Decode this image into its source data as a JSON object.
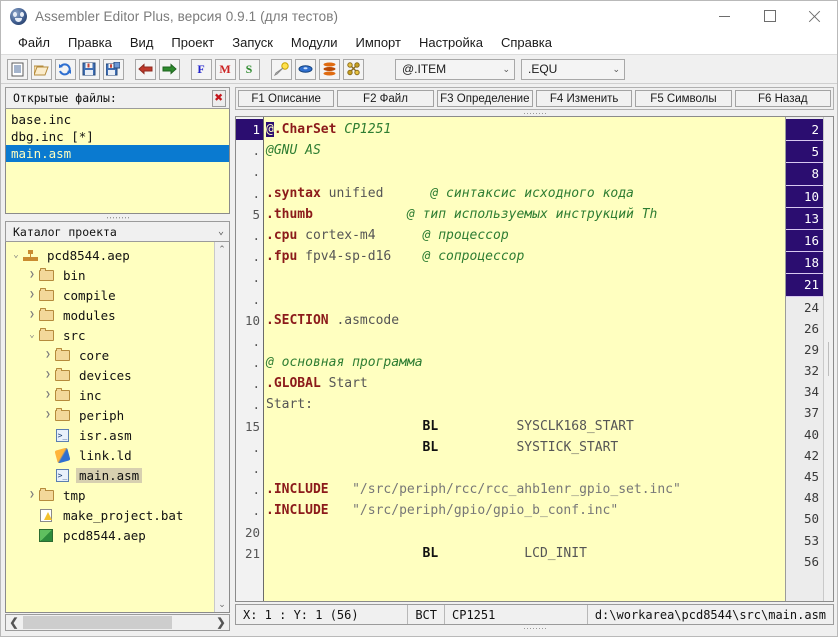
{
  "window": {
    "title": "Assembler Editor Plus, версия 0.9.1 (для тестов)",
    "app_icon": "paw-icon",
    "minimize": "minimize-icon",
    "maximize": "maximize-icon",
    "close": "close-icon"
  },
  "menu": [
    {
      "label": "Файл"
    },
    {
      "label": "Правка"
    },
    {
      "label": "Вид"
    },
    {
      "label": "Проект"
    },
    {
      "label": "Запуск"
    },
    {
      "label": "Модули"
    },
    {
      "label": "Импорт"
    },
    {
      "label": "Настройка"
    },
    {
      "label": "Справка"
    }
  ],
  "toolbar": {
    "buttons": [
      {
        "name": "new-file-icon",
        "glyph": "▤",
        "color": "#3b5a8c"
      },
      {
        "name": "open-folder-icon",
        "glyph": "▭",
        "color": "#c8963e"
      },
      {
        "name": "refresh-icon",
        "glyph": "⟳",
        "color": "#2f6fd0"
      },
      {
        "name": "save-icon",
        "glyph": "▣",
        "color": "#2f6fd0"
      },
      {
        "name": "save-all-icon",
        "glyph": "▣",
        "color": "#2f6fd0"
      },
      {
        "name": "back-arrow-icon",
        "glyph": "←",
        "color": "#c0392b"
      },
      {
        "name": "forward-arrow-icon",
        "glyph": "→",
        "color": "#2e8b2e"
      },
      {
        "name": "find-icon",
        "glyph": "F",
        "color": "#2222cc"
      },
      {
        "name": "macro-icon",
        "glyph": "M",
        "color": "#cc2222"
      },
      {
        "name": "symbols-icon",
        "glyph": "S",
        "color": "#2e8b2e"
      },
      {
        "name": "highlight-pen-icon",
        "glyph": "✐",
        "color": "#d8a400"
      },
      {
        "name": "disk-icon",
        "glyph": "⬬",
        "color": "#2f6fd0"
      },
      {
        "name": "stack-layers-icon",
        "glyph": "≡",
        "color": "#d04a00"
      },
      {
        "name": "link-nodes-icon",
        "glyph": "⁂",
        "color": "#b8860b"
      }
    ],
    "combo_item": {
      "value": "@.ITEM",
      "chevron": "chevron-down-icon"
    },
    "combo_equ": {
      "value": ".EQU",
      "chevron": "chevron-down-icon"
    }
  },
  "sidebar": {
    "files_panel": {
      "title": "Открытые файлы:",
      "close_icon": "✖",
      "items": [
        {
          "label": "base.inc",
          "selected": false
        },
        {
          "label": "dbg.inc [*]",
          "selected": false
        },
        {
          "label": "main.asm",
          "selected": true
        }
      ]
    },
    "tree_panel": {
      "title": "Каталог проекта",
      "chevron": "chevron-down-icon",
      "nodes": [
        {
          "label": "pcd8544.aep",
          "indent": 0,
          "arrow": "v",
          "icon": "project-icon",
          "selected": false
        },
        {
          "label": "bin",
          "indent": 1,
          "arrow": ">",
          "icon": "folder-icon",
          "selected": false
        },
        {
          "label": "compile",
          "indent": 1,
          "arrow": ">",
          "icon": "folder-icon",
          "selected": false
        },
        {
          "label": "modules",
          "indent": 1,
          "arrow": ">",
          "icon": "folder-icon",
          "selected": false
        },
        {
          "label": "src",
          "indent": 1,
          "arrow": "v",
          "icon": "folder-icon",
          "selected": false
        },
        {
          "label": "core",
          "indent": 2,
          "arrow": ">",
          "icon": "folder-icon",
          "selected": false
        },
        {
          "label": "devices",
          "indent": 2,
          "arrow": ">",
          "icon": "folder-icon",
          "selected": false
        },
        {
          "label": "inc",
          "indent": 2,
          "arrow": ">",
          "icon": "folder-icon",
          "selected": false
        },
        {
          "label": "periph",
          "indent": 2,
          "arrow": ">",
          "icon": "folder-icon",
          "selected": false
        },
        {
          "label": "isr.asm",
          "indent": 2,
          "arrow": "",
          "icon": "asm-file-icon",
          "selected": false
        },
        {
          "label": "link.ld",
          "indent": 2,
          "arrow": "",
          "icon": "linker-file-icon",
          "selected": false
        },
        {
          "label": "main.asm",
          "indent": 2,
          "arrow": "",
          "icon": "asm-file-icon",
          "selected": true
        },
        {
          "label": "tmp",
          "indent": 1,
          "arrow": ">",
          "icon": "folder-icon",
          "selected": false
        },
        {
          "label": "make_project.bat",
          "indent": 1,
          "arrow": "",
          "icon": "bat-file-icon",
          "selected": false
        },
        {
          "label": "pcd8544.aep",
          "indent": 1,
          "arrow": "",
          "icon": "aep-file-icon",
          "selected": false
        }
      ],
      "scroll_up": "scroll-up-icon",
      "scroll_down": "scroll-down-icon",
      "hscroll_left": "❮",
      "hscroll_right": "❯"
    }
  },
  "fkeys": [
    {
      "label": "F1 Описание"
    },
    {
      "label": "F2 Файл"
    },
    {
      "label": "F3 Определение"
    },
    {
      "label": "F4 Изменить"
    },
    {
      "label": "F5 Символы"
    },
    {
      "label": "F6 Назад"
    }
  ],
  "editor": {
    "gutter": [
      "1",
      ".",
      ".",
      ".",
      "5",
      ".",
      ".",
      ".",
      ".",
      "10",
      ".",
      ".",
      ".",
      ".",
      "15",
      ".",
      ".",
      ".",
      ".",
      "20",
      "21"
    ],
    "current_line": 1,
    "lines": [
      {
        "n": 1,
        "segs": [
          {
            "t": "@",
            "c": "cursorchar"
          },
          {
            "t": ".CharSet ",
            "c": "k"
          },
          {
            "t": "CP1251",
            "c": "cm"
          }
        ]
      },
      {
        "n": 2,
        "segs": [
          {
            "t": "@GNU AS",
            "c": "cm"
          }
        ]
      },
      {
        "n": 3,
        "segs": []
      },
      {
        "n": 4,
        "segs": [
          {
            "t": ".syntax ",
            "c": "k"
          },
          {
            "t": "unified",
            "c": "op"
          },
          {
            "t": "      ",
            "c": "op"
          },
          {
            "t": "@ синтаксис исходного кода",
            "c": "cm"
          }
        ]
      },
      {
        "n": 5,
        "segs": [
          {
            "t": ".thumb",
            "c": "k"
          },
          {
            "t": "            ",
            "c": "op"
          },
          {
            "t": "@ тип используемых инструкций Th",
            "c": "cm"
          }
        ]
      },
      {
        "n": 6,
        "segs": [
          {
            "t": ".cpu ",
            "c": "k"
          },
          {
            "t": "cortex-m4",
            "c": "op"
          },
          {
            "t": "      ",
            "c": "op"
          },
          {
            "t": "@ процессор",
            "c": "cm"
          }
        ]
      },
      {
        "n": 7,
        "segs": [
          {
            "t": ".fpu ",
            "c": "k"
          },
          {
            "t": "fpv4-sp-d16",
            "c": "op"
          },
          {
            "t": "    ",
            "c": "op"
          },
          {
            "t": "@ сопроцессор",
            "c": "cm"
          }
        ]
      },
      {
        "n": 8,
        "segs": []
      },
      {
        "n": 9,
        "segs": []
      },
      {
        "n": 10,
        "segs": [
          {
            "t": ".SECTION ",
            "c": "k"
          },
          {
            "t": ".asmcode",
            "c": "op"
          }
        ]
      },
      {
        "n": 11,
        "segs": []
      },
      {
        "n": 12,
        "segs": [
          {
            "t": "@ основная программа",
            "c": "cm"
          }
        ]
      },
      {
        "n": 13,
        "segs": [
          {
            "t": ".GLOBAL ",
            "c": "k"
          },
          {
            "t": "Start",
            "c": "op"
          }
        ]
      },
      {
        "n": 14,
        "segs": [
          {
            "t": "Start:",
            "c": "op"
          }
        ]
      },
      {
        "n": 15,
        "segs": [
          {
            "t": "                    ",
            "c": "op"
          },
          {
            "t": "BL",
            "c": "ins"
          },
          {
            "t": "          ",
            "c": "op"
          },
          {
            "t": "SYSCLK168_START",
            "c": "op"
          }
        ]
      },
      {
        "n": 16,
        "segs": [
          {
            "t": "                    ",
            "c": "op"
          },
          {
            "t": "BL",
            "c": "ins"
          },
          {
            "t": "          ",
            "c": "op"
          },
          {
            "t": "SYSTICK_START",
            "c": "op"
          }
        ]
      },
      {
        "n": 17,
        "segs": []
      },
      {
        "n": 18,
        "segs": [
          {
            "t": ".INCLUDE ",
            "c": "k"
          },
          {
            "t": "  \"/src/periph/rcc/rcc_ahb1enr_gpio_set.inc\"",
            "c": "str"
          }
        ]
      },
      {
        "n": 19,
        "segs": [
          {
            "t": ".INCLUDE ",
            "c": "k"
          },
          {
            "t": "  \"/src/periph/gpio/gpio_b_conf.inc\"",
            "c": "str"
          }
        ]
      },
      {
        "n": 20,
        "segs": []
      },
      {
        "n": 21,
        "segs": [
          {
            "t": "                    ",
            "c": "op"
          },
          {
            "t": "BL",
            "c": "ins"
          },
          {
            "t": "           ",
            "c": "op"
          },
          {
            "t": "LCD_INIT",
            "c": "op"
          }
        ]
      }
    ],
    "linemap": [
      {
        "label": "2",
        "hl": true
      },
      {
        "label": "5",
        "hl": true
      },
      {
        "label": "8",
        "hl": true
      },
      {
        "label": "10",
        "hl": true
      },
      {
        "label": "13",
        "hl": true
      },
      {
        "label": "16",
        "hl": true
      },
      {
        "label": "18",
        "hl": true
      },
      {
        "label": "21",
        "hl": true
      },
      {
        "label": "24",
        "hl": false
      },
      {
        "label": "26",
        "hl": false
      },
      {
        "label": "29",
        "hl": false
      },
      {
        "label": "32",
        "hl": false
      },
      {
        "label": "34",
        "hl": false
      },
      {
        "label": "37",
        "hl": false
      },
      {
        "label": "40",
        "hl": false
      },
      {
        "label": "42",
        "hl": false
      },
      {
        "label": "45",
        "hl": false
      },
      {
        "label": "48",
        "hl": false
      },
      {
        "label": "50",
        "hl": false
      },
      {
        "label": "53",
        "hl": false
      },
      {
        "label": "56",
        "hl": false
      }
    ]
  },
  "statusbar": {
    "position": "X: 1 : Y: 1 (56)",
    "mode": "ВСТ",
    "encoding": "CP1251",
    "path": "d:\\workarea\\pcd8544\\src\\main.asm"
  },
  "colors": {
    "editor_bg": "#ffffc0",
    "selection": "#0a7ad0",
    "highlight": "#2b0d70",
    "keyword": "#8b1a1a",
    "comment": "#2e7d32"
  }
}
